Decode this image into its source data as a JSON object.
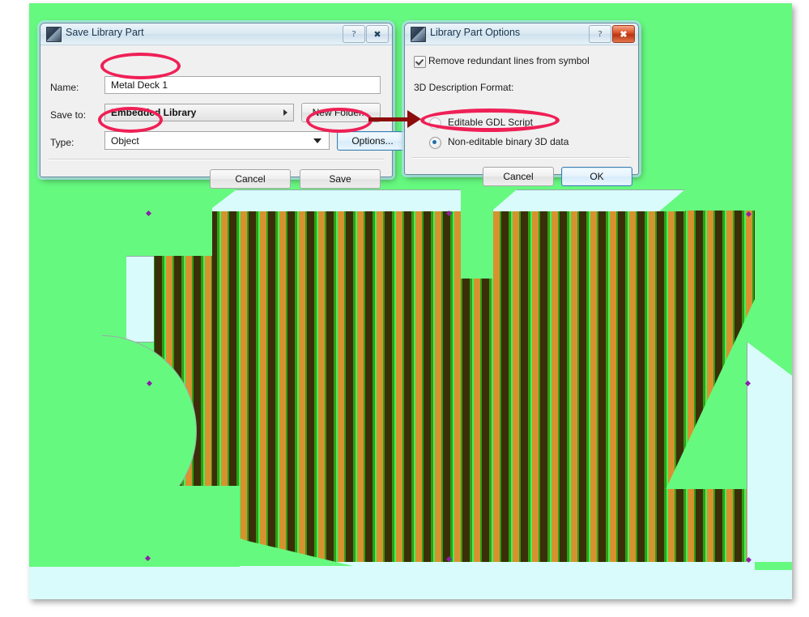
{
  "canvas": {
    "name": "archicad-floor-plan",
    "background_color": "#d9fbfb",
    "fill_color": "#66f97f",
    "hatch_colors": [
      "#3a2f09",
      "#d7922f",
      "#2f9f14",
      "#44f259"
    ]
  },
  "save_dialog": {
    "title": "Save Library Part",
    "help_button": "?",
    "close_button": "✖",
    "fields": [
      {
        "label": "Name:",
        "value": "Metal Deck 1"
      },
      {
        "label": "Save to:",
        "value": "Embedded Library"
      },
      {
        "label": "Type:",
        "value": "Object"
      }
    ],
    "new_folder_button": "New Folder...",
    "options_button": "Options...",
    "cancel_button": "Cancel",
    "save_button": "Save"
  },
  "options_dialog": {
    "title": "Library Part Options",
    "help_button": "?",
    "close_button": "✖",
    "checkbox_label": "Remove redundant lines from symbol",
    "checkbox_checked": true,
    "group_label": "3D Description Format:",
    "radios": [
      {
        "label": "Editable GDL Script",
        "selected": false
      },
      {
        "label": "Non-editable binary 3D data",
        "selected": true
      }
    ],
    "cancel_button": "Cancel",
    "ok_button": "OK"
  },
  "annotations": {
    "highlight_color": "#ef2056",
    "arrow_color": "#8d0d0d",
    "marks": [
      "name-field-highlight",
      "type-value-highlight",
      "options-button-highlight",
      "binary-3d-radio-highlight",
      "options-to-dialog-arrow"
    ]
  }
}
